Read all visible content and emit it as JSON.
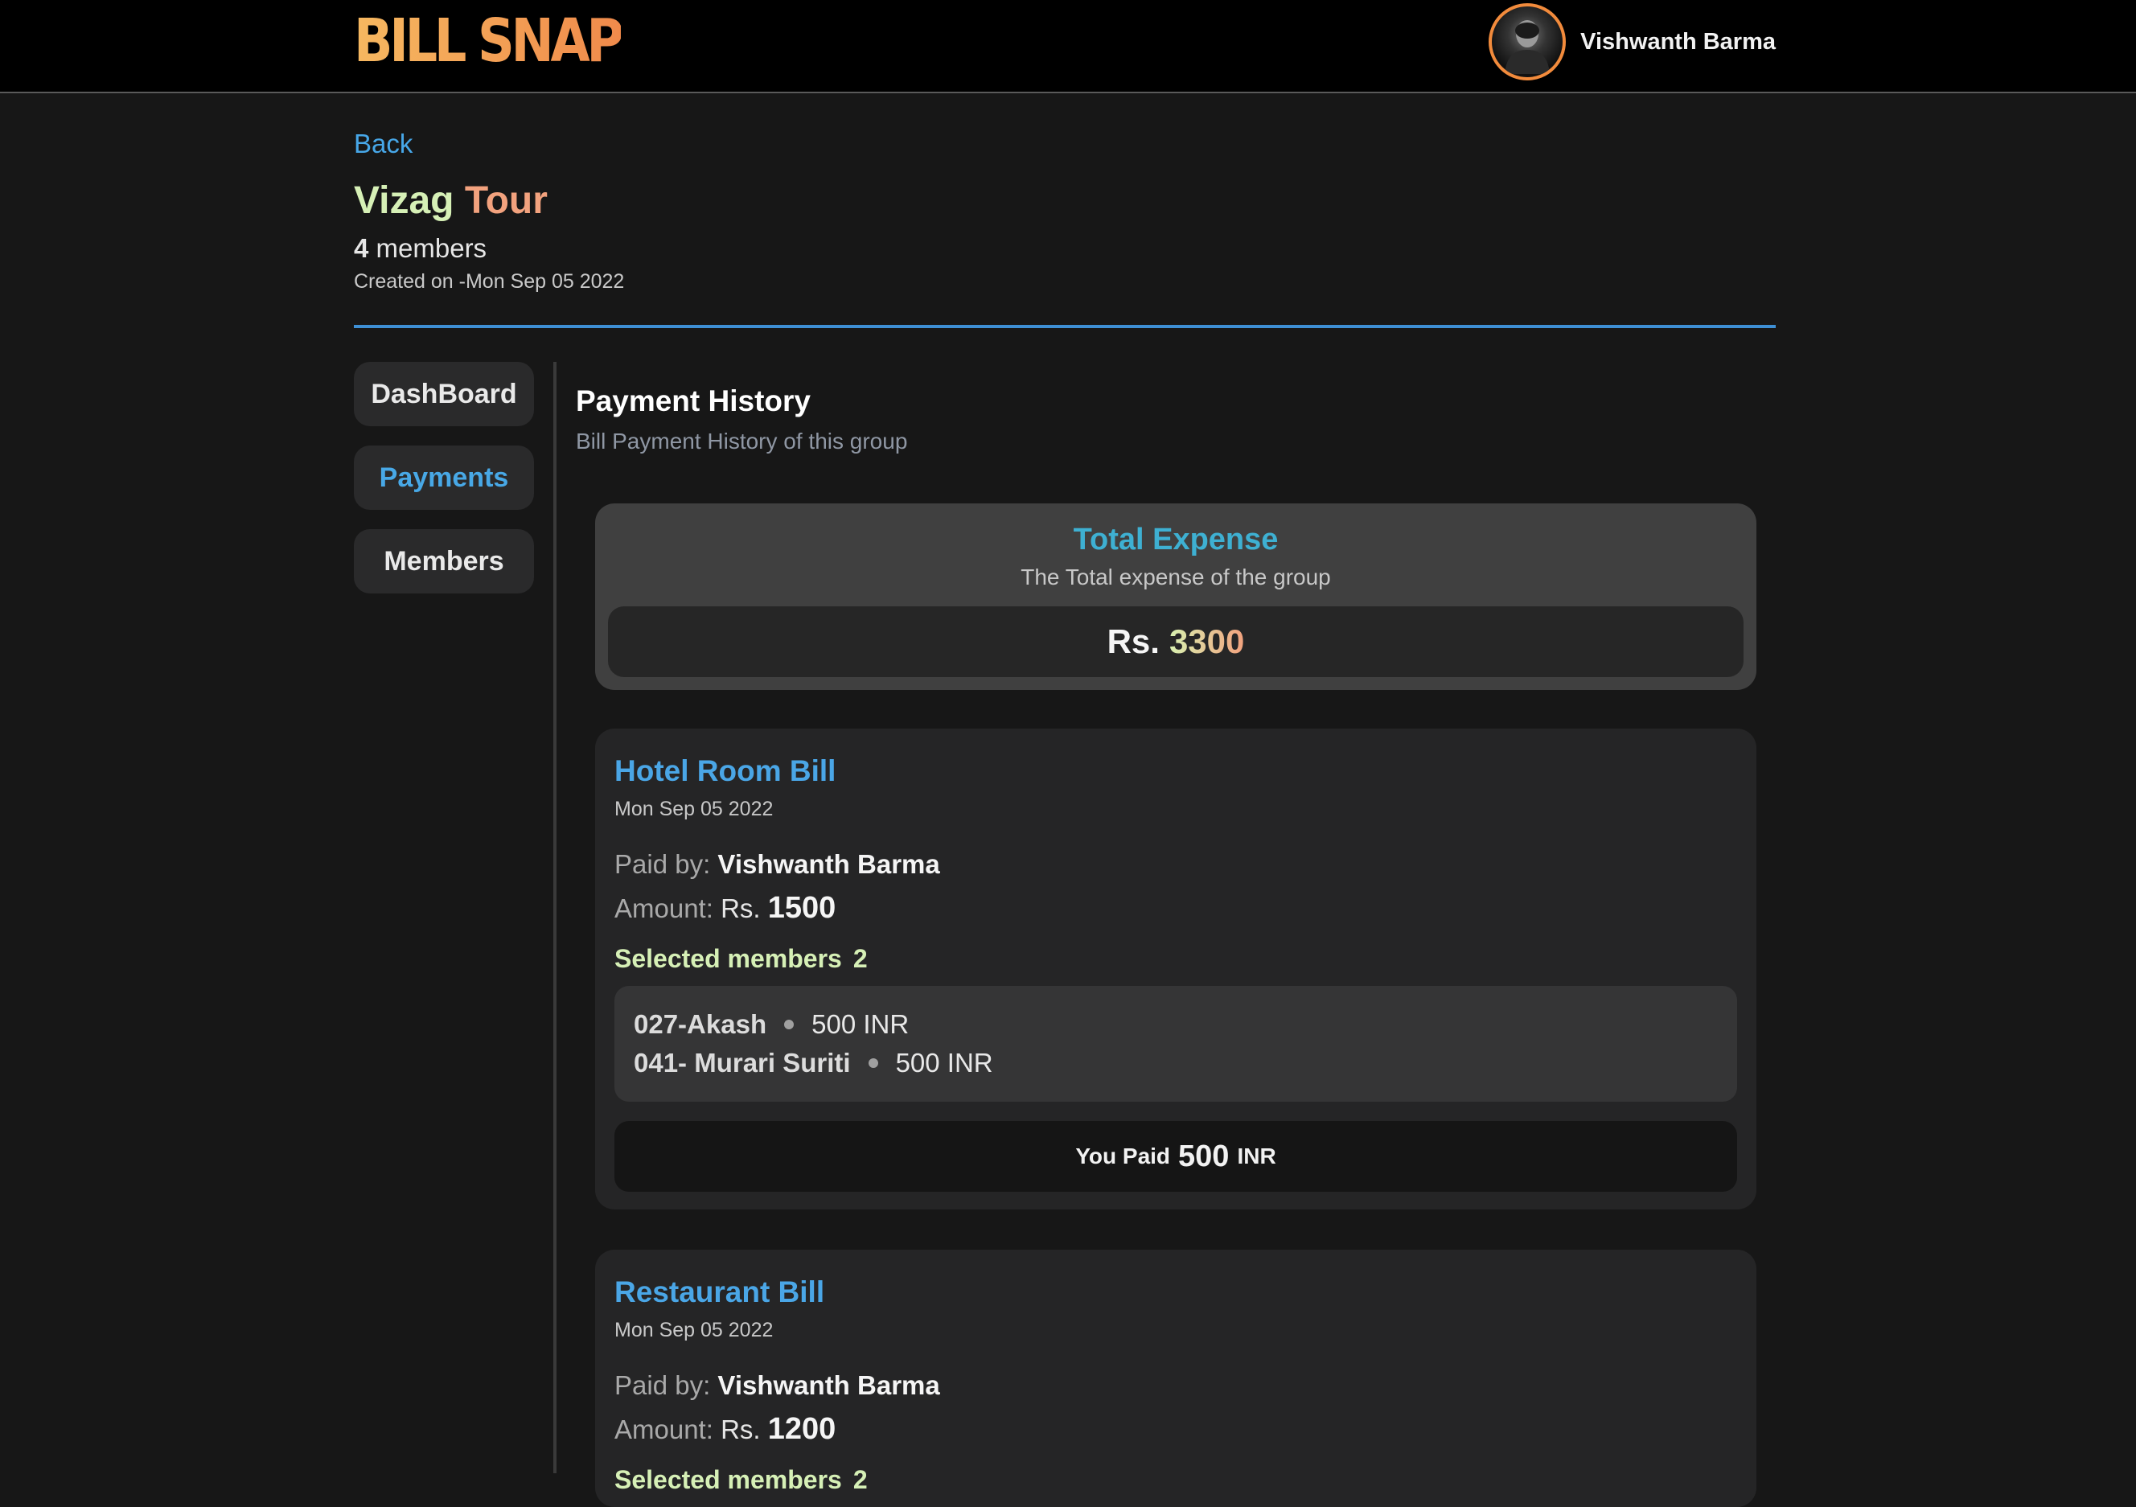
{
  "app": {
    "logo": "BILL SNAP"
  },
  "user": {
    "name": "Vishwanth Barma"
  },
  "nav": {
    "back_label": "Back"
  },
  "group": {
    "title_part1": "Vizag",
    "title_part2": "Tour",
    "member_count": "4",
    "member_label": "members",
    "created": "Created on -Mon Sep 05 2022"
  },
  "sidebar": {
    "items": [
      {
        "label": "DashBoard"
      },
      {
        "label": "Payments"
      },
      {
        "label": "Members"
      }
    ]
  },
  "section": {
    "title": "Payment History",
    "subtitle": "Bill Payment History of this group"
  },
  "total": {
    "title": "Total Expense",
    "subtitle": "The Total expense of the group",
    "currency": "Rs.",
    "value": "3300"
  },
  "bills": [
    {
      "title": "Hotel Room Bill",
      "date": "Mon Sep 05 2022",
      "paid_by_label": "Paid by:",
      "paid_by": "Vishwanth Barma",
      "amount_label": "Amount:",
      "amount_currency": "Rs.",
      "amount": "1500",
      "selected_label": "Selected members",
      "selected_count": "2",
      "members": [
        {
          "name": "027-Akash",
          "amount": "500 INR"
        },
        {
          "name": "041- Murari Suriti",
          "amount": "500 INR"
        }
      ],
      "you_paid_label": "You Paid",
      "you_paid_value": "500",
      "you_paid_unit": "INR"
    },
    {
      "title": "Restaurant Bill",
      "date": "Mon Sep 05 2022",
      "paid_by_label": "Paid by:",
      "paid_by": "Vishwanth Barma",
      "amount_label": "Amount:",
      "amount_currency": "Rs.",
      "amount": "1200",
      "selected_label": "Selected members",
      "selected_count": "2"
    }
  ],
  "colors": {
    "accent_blue": "#47a7e8",
    "logo_orange": "#f4a35a",
    "highlight_green": "#d6f0b6",
    "highlight_salmon": "#f2a27e"
  }
}
